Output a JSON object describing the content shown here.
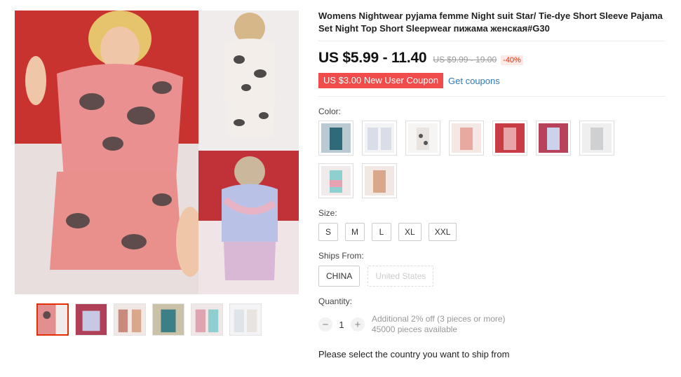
{
  "product": {
    "title": "Womens Nightwear pyjama femme Night suit Star/ Tie-dye Short Sleeve Pajama Set Night Top Short Sleepwear пижама женская#G30",
    "price": "US $5.99 - 11.40",
    "old_price": "US $9.99 - 19.00",
    "discount": "-40%"
  },
  "coupon": {
    "badge": "US $3.00 New User Coupon",
    "link": "Get coupons"
  },
  "color": {
    "label": "Color:",
    "swatches": [
      "#2f6a78",
      "#d8dde8",
      "#e9e4df",
      "#e8a9a0",
      "#c83d45",
      "#b8425a",
      "#cfd0d2",
      "#8ecfcf",
      "#d9a88c"
    ]
  },
  "size": {
    "label": "Size:",
    "options": [
      "S",
      "M",
      "L",
      "XL",
      "XXL"
    ]
  },
  "ships_from": {
    "label": "Ships From:",
    "options": [
      "CHINA",
      "United States"
    ]
  },
  "quantity": {
    "label": "Quantity:",
    "value": "1",
    "minus": "−",
    "plus": "+",
    "offer": "Additional 2% off (3 pieces or more)",
    "available": "45000 pieces available"
  },
  "shipping_note": "Please select the country you want to ship from",
  "gallery": {
    "thumb_colors": [
      "#e38f8f",
      "#b04058",
      "#c98a7c",
      "#3d7f86",
      "#e0a3b0",
      "#dfe3ea"
    ]
  }
}
